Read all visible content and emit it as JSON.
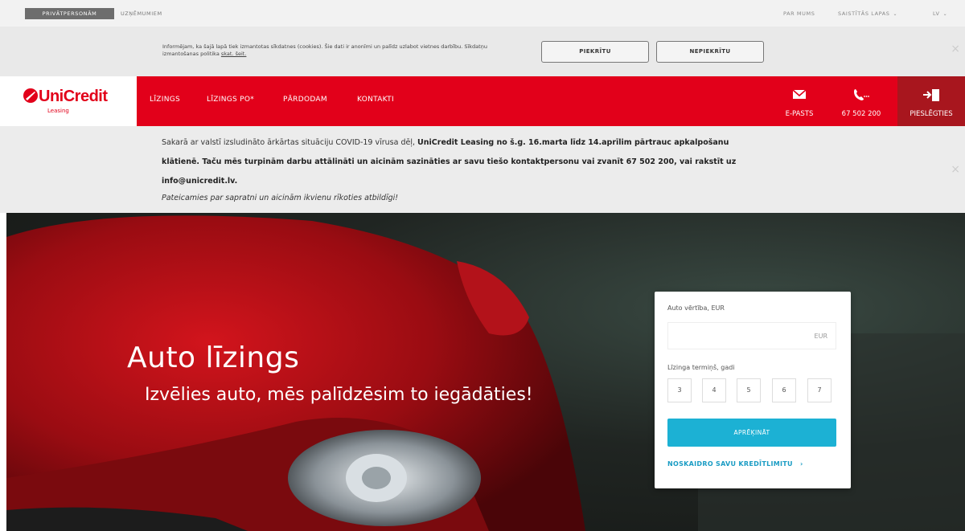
{
  "topbar": {
    "segment_private": "PRIVĀTPERSONĀM",
    "segment_business": "UZŅĒMUMIEM",
    "about": "PAR MUMS",
    "related": "SAISTĪTĀS LAPAS",
    "lang": "LV"
  },
  "cookie": {
    "text": "Informējam, ka šajā lapā tiek izmantotas sīkdatnes (cookies). Šie dati ir anonīmi un palīdz uzlabot vietnes darbību. Sīkdatņu izmantošanas politika",
    "link": "skat. šeit.",
    "accept": "PIEKRĪTU",
    "decline": "NEPIEKRĪTU",
    "close": "×"
  },
  "brand": {
    "name": "UniCredit",
    "sub": "Leasing",
    "color": "#e2001a"
  },
  "nav": {
    "items": [
      "LĪZINGS",
      "LĪZINGS PO*",
      "PĀRDODAM",
      "KONTAKTI"
    ],
    "email_label": "E-PASTS",
    "phone_label": "67 502 200",
    "login_label": "PIESLĒGTIES"
  },
  "notice": {
    "line1_pre": "Sakarā ar valstī izsludināto ārkārtas situāciju COVID-19 vīrusa dēļ,",
    "line1_bold": "UniCredit Leasing no š.g. 16.marta līdz 14.aprīlim pārtrauc apkalpošanu",
    "line2_bold": "klātienē. Taču mēs turpinām darbu attālināti un aicinām sazināties ar savu tiešo kontaktpersonu vai zvanīt 67 502 200, vai rakstīt uz",
    "line3_bold": "info@unicredit.lv.",
    "line4_italic": "Pateicamies par sapratni un aicinām ikvienu rīkoties atbildīgi!",
    "close": "×"
  },
  "hero": {
    "title": "Auto līzings",
    "subtitle": "Izvēlies auto, mēs palīdzēsim to iegādāties!"
  },
  "calculator": {
    "value_label": "Auto vērtība, EUR",
    "currency": "EUR",
    "term_label": "Līzinga termiņš, gadi",
    "terms": [
      "3",
      "4",
      "5",
      "6",
      "7"
    ],
    "calc_button": "APRĒĶINĀT",
    "credit_link": "NOSKAIDRO SAVU KREDĪTLIMITU",
    "accent": "#1cb1d4"
  }
}
